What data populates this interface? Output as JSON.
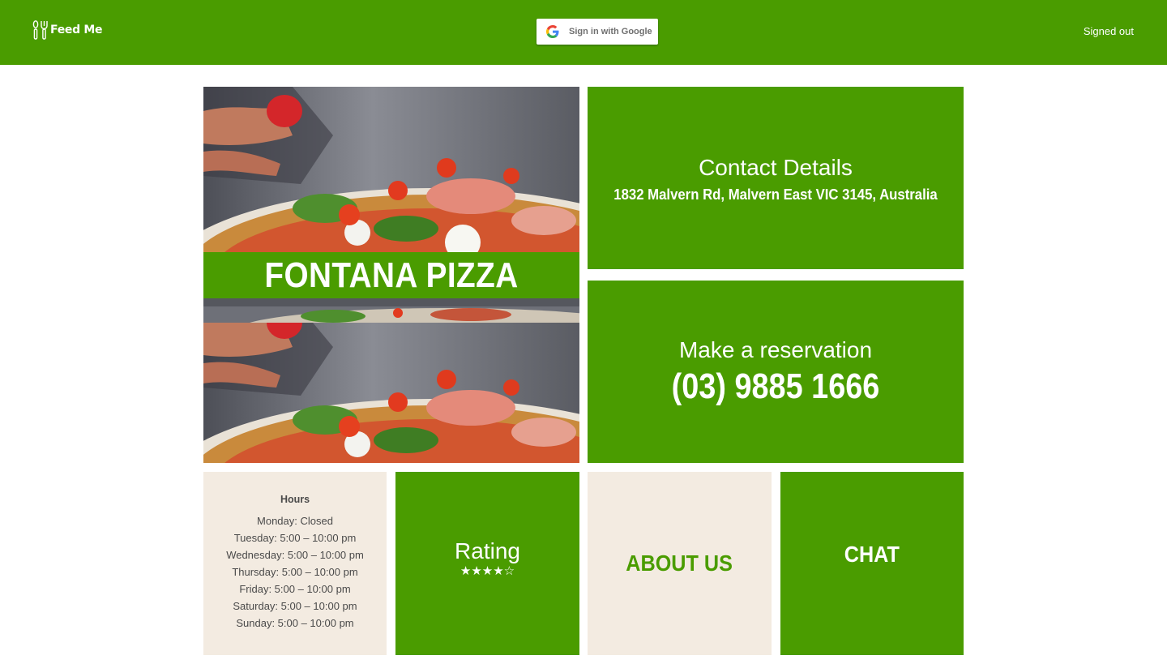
{
  "header": {
    "logo_text": "Feed Me",
    "google_button_label": "Sign in with Google",
    "auth_status": "Signed out"
  },
  "restaurant": {
    "name": "FONTANA PIZZA"
  },
  "contact": {
    "heading": "Contact Details",
    "address": "1832 Malvern Rd, Malvern East VIC 3145, Australia"
  },
  "reservation": {
    "heading": "Make a reservation",
    "phone": "(03) 9885 1666"
  },
  "hours": {
    "heading": "Hours",
    "days": [
      "Monday: Closed",
      "Tuesday: 5:00 – 10:00 pm",
      "Wednesday: 5:00 – 10:00 pm",
      "Thursday: 5:00 – 10:00 pm",
      "Friday: 5:00 – 10:00 pm",
      "Saturday: 5:00 – 10:00 pm",
      "Sunday: 5:00 – 10:00 pm"
    ]
  },
  "rating": {
    "heading": "Rating",
    "stars_filled": 4,
    "stars_total": 5
  },
  "tiles": {
    "about_label": "ABOUT US",
    "chat_label": "CHAT"
  },
  "colors": {
    "brand_green": "#4a9c00",
    "beige": "#f3ebe1",
    "hours_text": "#4a4a4a"
  },
  "icons": {
    "logo": "fork-knife-icon",
    "google": "google-g-icon",
    "star_filled": "star-filled-icon",
    "star_empty": "star-empty-icon"
  }
}
